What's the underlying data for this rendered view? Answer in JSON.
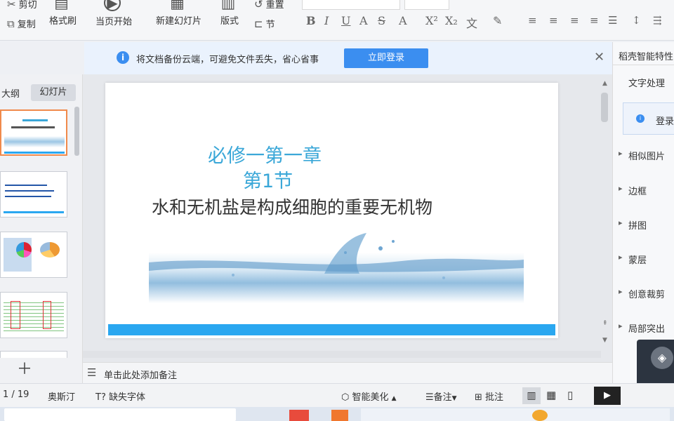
{
  "ribbon": {
    "cut": "剪切",
    "copy": "复制",
    "format_painter": "格式刷",
    "start_from_current": "当页开始",
    "new_slide": "新建幻灯片",
    "layout": "版式",
    "section": "节",
    "reset": "重置"
  },
  "notify": {
    "message": "将文档备份云端，可避免文件丢失，省心省事",
    "login_button": "立即登录"
  },
  "left_panel": {
    "tab_outline": "大纲",
    "tab_slides": "幻灯片",
    "add_icon": "plus-icon"
  },
  "slide": {
    "title_line1": "必修一第一章",
    "title_line2": "第1节",
    "subtitle": "水和无机盐是构成细胞的重要无机物"
  },
  "notes": {
    "placeholder": "单击此处添加备注"
  },
  "right_panel": {
    "header": "稻壳智能特性",
    "section": "文字处理",
    "login": "登录",
    "items": [
      "相似图片",
      "边框",
      "拼图",
      "蒙层",
      "创意裁剪",
      "局部突出"
    ]
  },
  "status": {
    "page": "1 / 19",
    "theme": "奥斯汀",
    "missing_font": "缺失字体",
    "smart_beautify": "智能美化",
    "notes": "备注",
    "comments": "批注"
  },
  "colors": {
    "accent": "#3b8ef0",
    "slide_title": "#3aa7d8",
    "slide_bar": "#2aa7f0"
  }
}
